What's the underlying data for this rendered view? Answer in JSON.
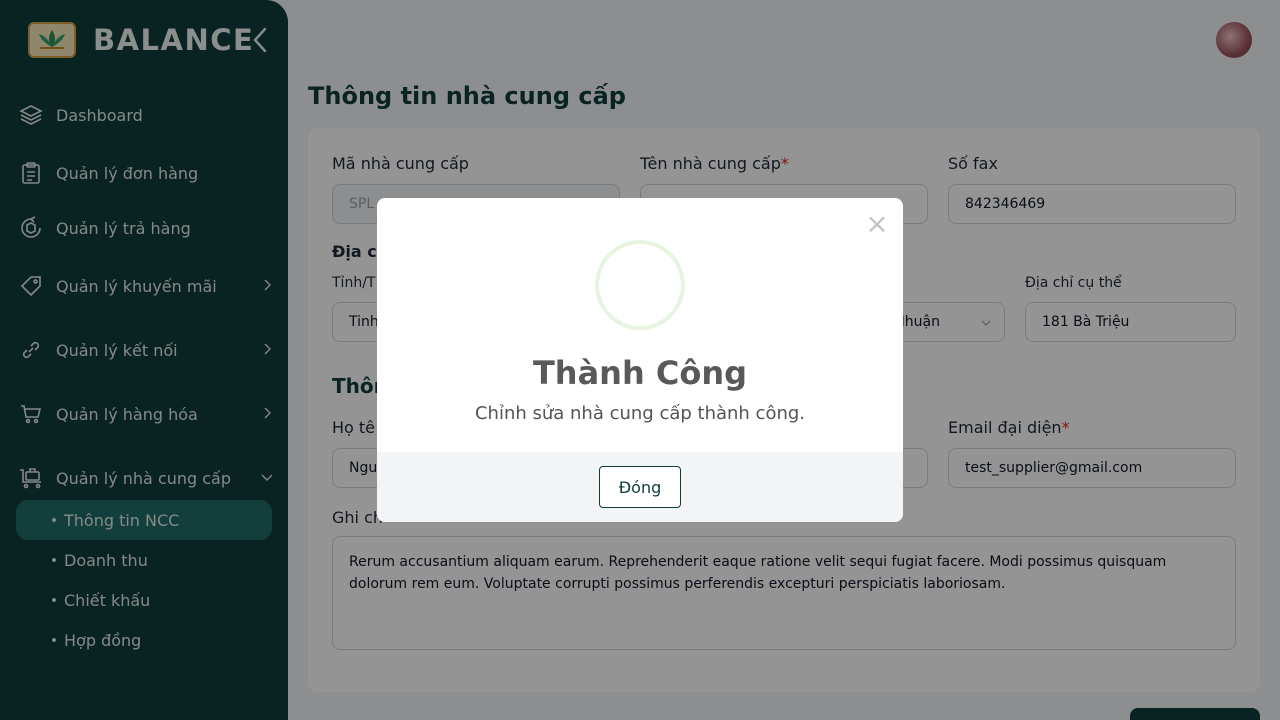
{
  "brand": {
    "name": "BALANCE"
  },
  "sidebar": {
    "items": [
      {
        "label": "Dashboard",
        "icon": "layers-icon"
      },
      {
        "label": "Quản lý đơn hàng",
        "icon": "clipboard-icon"
      },
      {
        "label": "Quản lý trả hàng",
        "icon": "return-box-icon"
      },
      {
        "label": "Quản lý khuyến mãi",
        "icon": "tag-icon",
        "has_children": true
      },
      {
        "label": "Quản lý kết nối",
        "icon": "link-icon",
        "has_children": true
      },
      {
        "label": "Quản lý hàng hóa",
        "icon": "cart-icon",
        "has_children": true
      },
      {
        "label": "Quản lý nhà cung cấp",
        "icon": "supplier-icon",
        "has_children": true,
        "expanded": true
      }
    ],
    "subitems": [
      {
        "label": "Thông tin NCC",
        "active": true
      },
      {
        "label": "Doanh thu"
      },
      {
        "label": "Chiết khấu"
      },
      {
        "label": "Hợp đồng"
      }
    ]
  },
  "page": {
    "title": "Thông tin nhà cung cấp"
  },
  "form": {
    "supplier_code": {
      "label": "Mã nhà cung cấp",
      "value": "SPL"
    },
    "supplier_name": {
      "label": "Tên nhà cung cấp",
      "required": "*"
    },
    "fax": {
      "label": "Số fax",
      "value": "842346469"
    },
    "address_section": "Địa ch",
    "province": {
      "label": "Tỉnh/T",
      "value": "Tinh"
    },
    "district": {
      "value": "Nhuận"
    },
    "address_detail": {
      "label": "Địa chỉ cụ thể",
      "value": "181 Bà Triệu"
    },
    "contact_section": "Thôn",
    "rep_name": {
      "label": "Họ tê",
      "value": "Ngu"
    },
    "rep_email": {
      "label": "Email đại diện",
      "required": "*",
      "value": "test_supplier@gmail.com"
    },
    "note": {
      "label": "Ghi ch",
      "value": "Rerum accusantium aliquam earum. Reprehenderit eaque ratione velit sequi fugiat facere. Modi possimus quisquam dolorum rem eum. Voluptate corrupti possimus perferendis excepturi perspiciatis laboriosam."
    }
  },
  "modal": {
    "title": "Thành Công",
    "message": "Chỉnh sửa nhà cung cấp thành công.",
    "close_label": "Đóng",
    "close_icon": "×"
  },
  "colors": {
    "sidebar": "#0f3d3a",
    "accent": "#1f6d66",
    "required": "#dc2626"
  }
}
